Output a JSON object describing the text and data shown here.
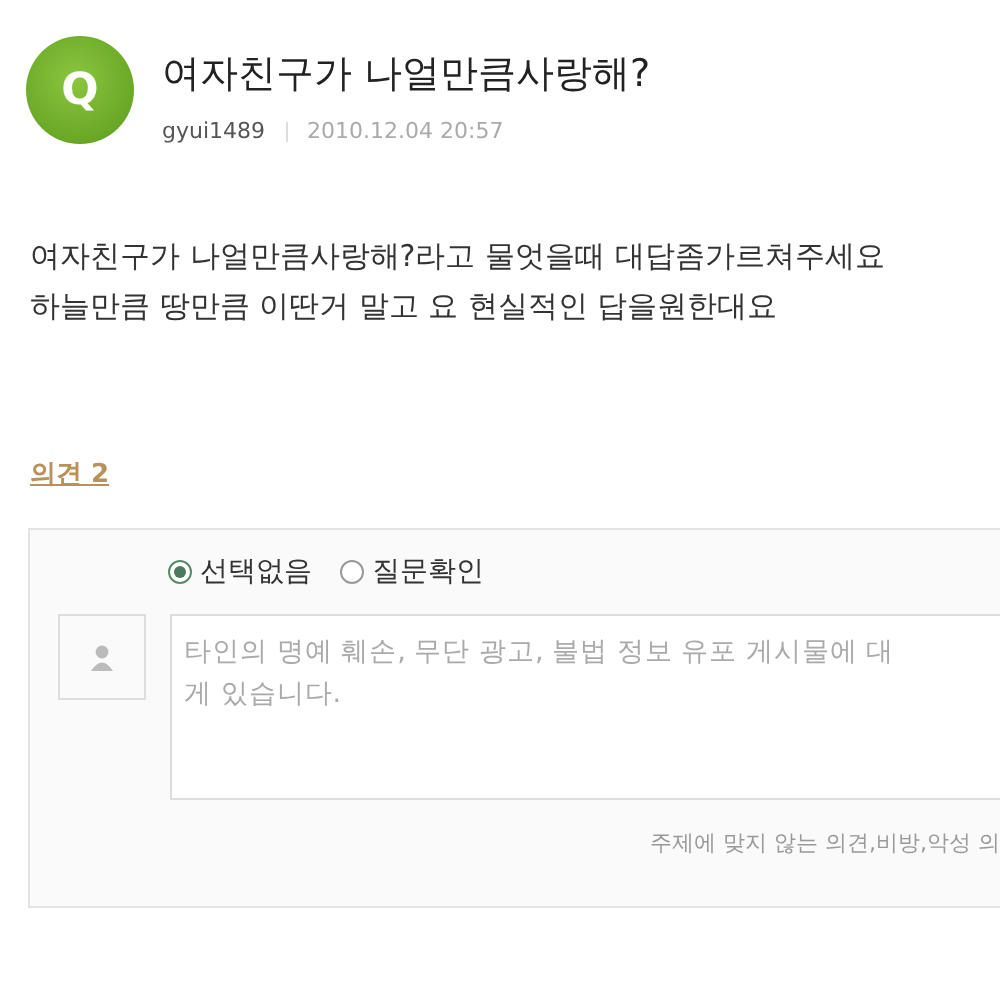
{
  "question": {
    "badge": "Q",
    "title": "여자친구가 나얼만큼사랑해?",
    "author": "gyui1489",
    "date": "2010.12.04 20:57"
  },
  "body": [
    "여자친구가 나얼만큼사랑해?라고 물엇을때 대답좀가르쳐주세요",
    "하늘만큼 땅만큼 이딴거 말고 요 현실적인 답을원한대요"
  ],
  "opinions_link": "의견 2",
  "comment_form": {
    "options": [
      {
        "label": "선택없음",
        "selected": true
      },
      {
        "label": "질문확인",
        "selected": false
      }
    ],
    "placeholder": [
      "타인의 명예 훼손, 무단 광고, 불법 정보 유포 게시물에 대",
      "게 있습니다."
    ],
    "notice": "주제에 맞지 않는 의견,비방,악성 의"
  }
}
